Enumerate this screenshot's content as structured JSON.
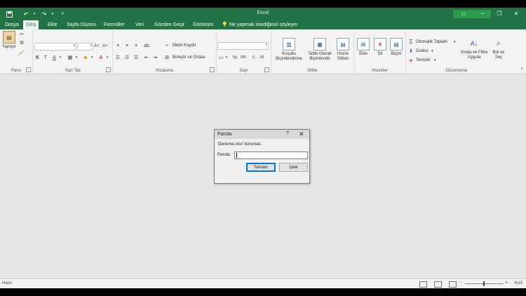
{
  "window": {
    "title": "Excel"
  },
  "qat": {
    "save_icon": "save-icon",
    "undo_icon": "undo-icon",
    "redo_icon": "redo-icon",
    "customize_icon": "customize-qat-icon"
  },
  "tabs": [
    {
      "label": "Dosya",
      "active": false
    },
    {
      "label": "Giriş",
      "active": true
    },
    {
      "label": "Ekle",
      "active": false
    },
    {
      "label": "Sayfa Düzeni",
      "active": false
    },
    {
      "label": "Formüller",
      "active": false
    },
    {
      "label": "Veri",
      "active": false
    },
    {
      "label": "Gözden Geçir",
      "active": false
    },
    {
      "label": "Görünüm",
      "active": false
    }
  ],
  "tell_me": "Ne yapmak istediğinizi söyleyin",
  "ribbon": {
    "clipboard": {
      "paste_label": "Yapıştır",
      "group_label": "Pano"
    },
    "font": {
      "bold": "K",
      "italic": "T",
      "underline": "A",
      "font_color": "A",
      "group_label": "Yazı Tipi"
    },
    "alignment": {
      "wrap_text": "Metni Kaydır",
      "merge_center": "Birleştir ve Ortala",
      "group_label": "Hizalama"
    },
    "number": {
      "percent": "%",
      "comma": "000",
      "group_label": "Sayı"
    },
    "styles": {
      "conditional": [
        "Koşullu",
        "Biçimlendirme"
      ],
      "table": [
        "Tablo Olarak",
        "Biçimlendir"
      ],
      "cell": [
        "Hücre",
        "Stilleri"
      ],
      "group_label": "Stiller"
    },
    "cells": {
      "insert": "Ekle",
      "delete": "Sil",
      "format": "Biçim",
      "group_label": "Hücreler"
    },
    "editing": {
      "autosum": "Otomatik Toplam",
      "fill": "Doldur",
      "clear": "Temizle",
      "sort": [
        "Sırala ve Filtre",
        "Uygula"
      ],
      "find": [
        "Bul ve",
        "Seç"
      ],
      "group_label": "Düzenleme"
    }
  },
  "dialog": {
    "title": "Parola",
    "help": "?",
    "close": "✕",
    "message": "'Deneme.xlsx' korumalı.",
    "password_label": "Parola:",
    "password_value": "",
    "ok": "Tamam",
    "cancel": "İptal"
  },
  "status": {
    "ready": "Hazır",
    "zoom": "%10",
    "zoom_minus": "-",
    "zoom_plus": "+"
  },
  "colors": {
    "accent": "#217346",
    "dialog_bg": "#f0f0f0",
    "workspace": "#e6e6e6"
  }
}
